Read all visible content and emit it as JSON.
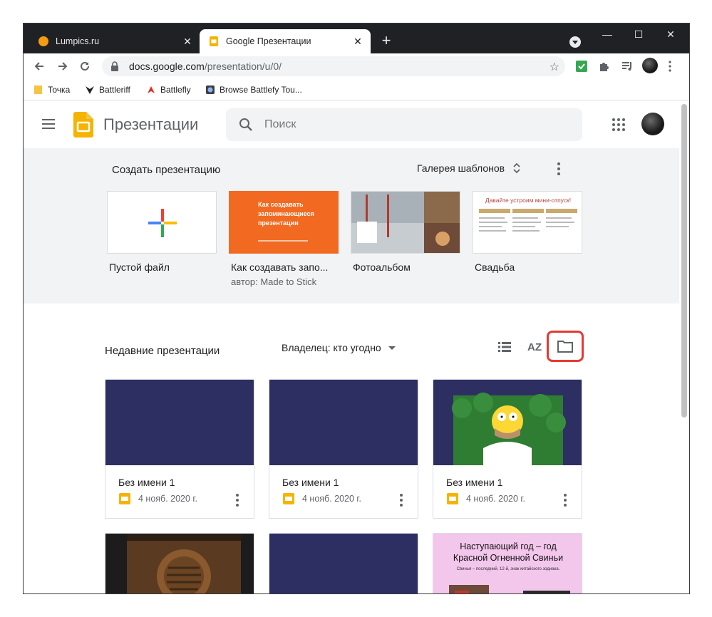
{
  "browser": {
    "tabs": [
      {
        "title": "Lumpics.ru",
        "active": false,
        "favicon": "orange-circle-icon"
      },
      {
        "title": "Google Презентации",
        "active": true,
        "favicon": "slides-icon"
      }
    ],
    "url_domain": "docs.google.com",
    "url_path": "/presentation/u/0/",
    "bookmarks": [
      {
        "label": "Точка",
        "icon": "folder-icon"
      },
      {
        "label": "Battleriff",
        "icon": "battleriff-icon"
      },
      {
        "label": "Battlefly",
        "icon": "battlefly-icon"
      },
      {
        "label": "Browse Battlefy Tou...",
        "icon": "battlefy-icon"
      }
    ]
  },
  "app": {
    "title": "Презентации",
    "search_placeholder": "Поиск"
  },
  "templates": {
    "heading": "Создать презентацию",
    "gallery_label": "Галерея шаблонов",
    "items": [
      {
        "name": "Пустой файл",
        "sub": ""
      },
      {
        "name": "Как создавать запо...",
        "sub": "автор: Made to Stick",
        "thumb_text": "Как создавать запоминающиеся презентации"
      },
      {
        "name": "Фотоальбом",
        "sub": ""
      },
      {
        "name": "Свадьба",
        "sub": "",
        "thumb_text": "Давайте устроим мини-отпуск!"
      }
    ]
  },
  "recent": {
    "heading": "Недавние презентации",
    "owner_filter": "Владелец: кто угодно",
    "sort_label": "AZ",
    "docs": [
      {
        "title": "Без имени 1",
        "date": "4 нояб. 2020 г."
      },
      {
        "title": "Без имени 1",
        "date": "4 нояб. 2020 г."
      },
      {
        "title": "Без имени 1",
        "date": "4 нояб. 2020 г."
      }
    ],
    "row2": {
      "card3_line1": "Наступающий год – год",
      "card3_line2": "Красной Огненной Свиньи",
      "card3_small": "Свинья – последний, 12-й, знак китайского зодиака."
    }
  },
  "colors": {
    "accent_red": "#e53935",
    "slides_yellow": "#f4b400",
    "preview_navy": "#2d2f63",
    "template_orange": "#f26a21"
  }
}
